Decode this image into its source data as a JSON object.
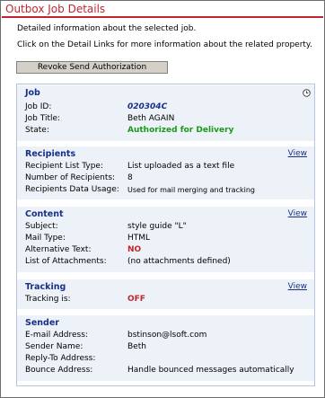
{
  "page": {
    "title": "Outbox Job Details",
    "intro": "Detailed information about the selected job.",
    "hint": "Click on the Detail Links for more information about the related property.",
    "revoke_button": "Revoke Send Authorization"
  },
  "colors": {
    "title": "#c0272d",
    "section_title": "#17308a",
    "section_bg": "#edf1f8",
    "authorized": "#1a9a1a",
    "alert": "#c0272d"
  },
  "sections": {
    "job": {
      "title": "Job",
      "icon": "clock-icon",
      "rows": [
        {
          "label": "Job ID:",
          "value": "020304C"
        },
        {
          "label": "Job Title:",
          "value": "Beth AGAIN"
        },
        {
          "label": "State:",
          "value": "Authorized for Delivery"
        }
      ]
    },
    "recipients": {
      "title": "Recipients",
      "link": "View",
      "rows": [
        {
          "label": "Recipient List Type:",
          "value": "List uploaded as a text file"
        },
        {
          "label": "Number of Recipients:",
          "value": "8"
        },
        {
          "label": "Recipients Data Usage:",
          "value": "Used for mail merging and tracking"
        }
      ]
    },
    "content": {
      "title": "Content",
      "link": "View",
      "rows": [
        {
          "label": "Subject:",
          "value": "style guide \"L\""
        },
        {
          "label": "Mail Type:",
          "value": "HTML"
        },
        {
          "label": "Alternative Text:",
          "value": "NO"
        },
        {
          "label": "List of Attachments:",
          "value": "(no attachments defined)"
        }
      ]
    },
    "tracking": {
      "title": "Tracking",
      "link": "View",
      "rows": [
        {
          "label": "Tracking is:",
          "value": "OFF"
        }
      ]
    },
    "sender": {
      "title": "Sender",
      "rows": [
        {
          "label": "E-mail Address:",
          "value": "bstinson@lsoft.com"
        },
        {
          "label": "Sender Name:",
          "value": "Beth"
        },
        {
          "label": "Reply-To Address:",
          "value": ""
        },
        {
          "label": "Bounce Address:",
          "value": "Handle bounced messages automatically"
        }
      ]
    }
  }
}
